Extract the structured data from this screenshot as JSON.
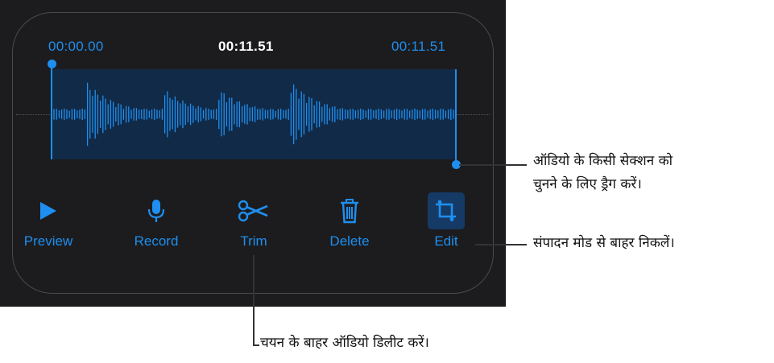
{
  "times": {
    "start": "00:00.00",
    "current": "00:11.51",
    "end": "00:11.51"
  },
  "toolbar": {
    "preview_label": "Preview",
    "record_label": "Record",
    "trim_label": "Trim",
    "delete_label": "Delete",
    "edit_label": "Edit"
  },
  "callouts": {
    "drag_line1": "ऑडियो के किसी सेक्शन को",
    "drag_line2": "चुनने के लिए ड्रैग करें।",
    "exit_edit": "संपादन मोड से बाहर निकलें।",
    "trim_delete": "चयन के बाहर ऑडियो डिलीट करें।"
  },
  "colors": {
    "accent": "#1e8ff0",
    "background": "#1c1c1e",
    "selection": "#112a47",
    "edit_active_bg": "#163a66"
  },
  "icons": {
    "preview": "play-icon",
    "record": "microphone-icon",
    "trim": "scissors-icon",
    "delete": "trash-icon",
    "edit": "crop-icon"
  }
}
